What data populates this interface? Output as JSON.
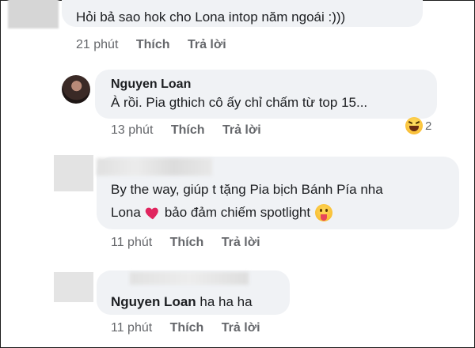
{
  "comments": [
    {
      "text": "Hỏi bả sao hok cho Lona intop năm ngoái :)))",
      "time": "21 phút",
      "like": "Thích",
      "reply": "Trả lời"
    },
    {
      "author": "Nguyen Loan",
      "text": "À rồi. Pia gthich cô ấy chỉ chấm từ top 15...",
      "time": "13 phút",
      "like": "Thích",
      "reply": "Trả lời",
      "reaction_count": "2",
      "reaction_icon": "haha-emoji-icon"
    },
    {
      "line1": "By the way, giúp t tặng Pia bịch Bánh Pía nha",
      "line2_start": "Lona",
      "line2_end": "bảo đảm chiếm spotlight",
      "time": "11 phút",
      "like": "Thích",
      "reply": "Trả lời",
      "icons": [
        "heart-emoji-icon",
        "tongue-out-emoji-icon"
      ]
    },
    {
      "mention": "Nguyen Loan",
      "text": "ha ha ha",
      "time": "11 phút",
      "like": "Thích",
      "reply": "Trả lời"
    }
  ],
  "colors": {
    "bubble": "#f0f2f5",
    "meta": "#65676b",
    "text": "#1c1e21",
    "heart": "#e0245e"
  }
}
